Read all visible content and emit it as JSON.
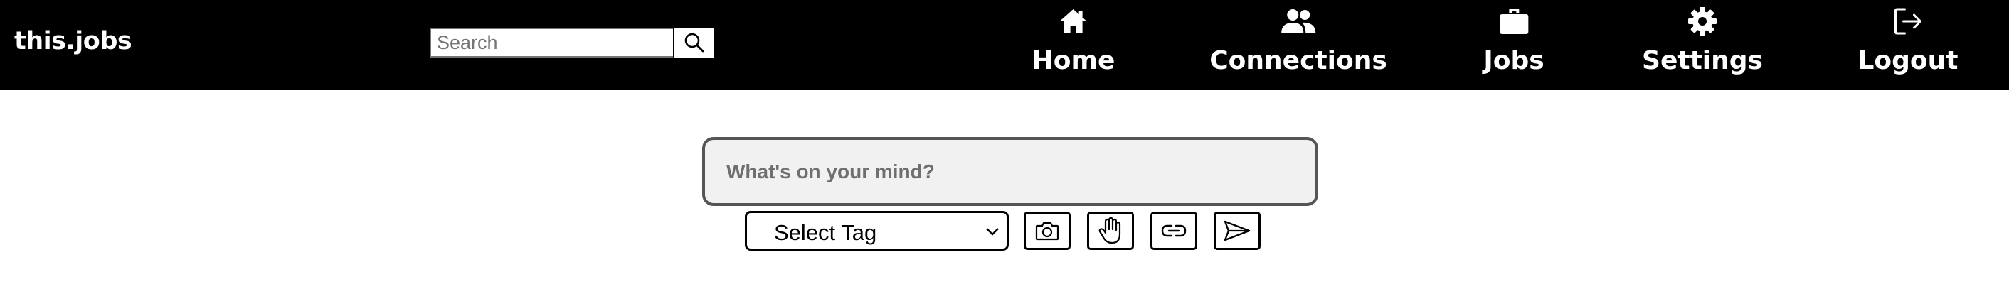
{
  "header": {
    "brand": "this.jobs",
    "search": {
      "placeholder": "Search",
      "button_icon": "search-icon"
    },
    "nav": [
      {
        "label": "Home",
        "icon": "home-icon"
      },
      {
        "label": "Connections",
        "icon": "people-icon"
      },
      {
        "label": "Jobs",
        "icon": "briefcase-icon"
      },
      {
        "label": "Settings",
        "icon": "gear-icon"
      },
      {
        "label": "Logout",
        "icon": "logout-icon"
      }
    ]
  },
  "composer": {
    "placeholder": "What's on your mind?",
    "tag_select": {
      "selected": "Select Tag"
    },
    "tools": [
      "camera-icon",
      "hand-icon",
      "link-icon",
      "send-icon"
    ]
  },
  "colors": {
    "navbar": "#000000",
    "nav_text": "#ffffff",
    "input_bg": "#f1f1f1",
    "input_border": "#555555"
  }
}
